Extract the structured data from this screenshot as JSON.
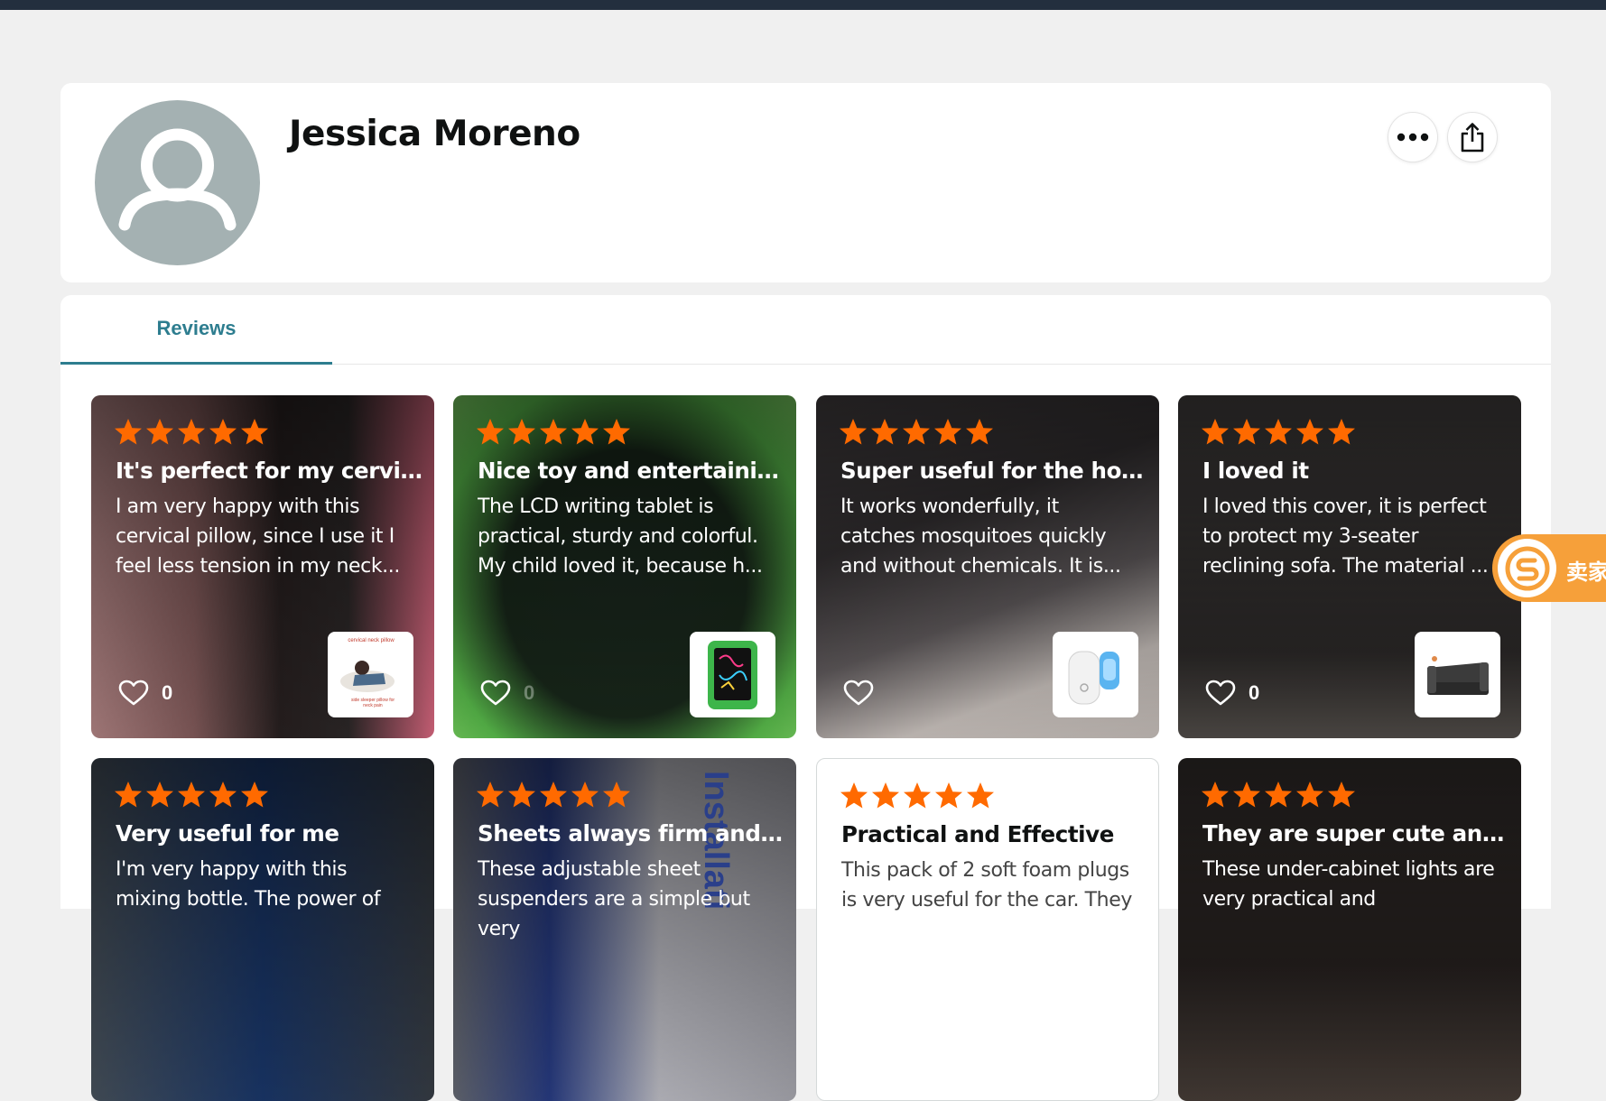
{
  "profile": {
    "name": "Jessica Moreno"
  },
  "tabs": {
    "reviews_label": "Reviews"
  },
  "colors": {
    "star": "#ff6a00",
    "accent": "#2d7d8f",
    "avatar_bg": "#a4b1b2"
  },
  "reviews": [
    {
      "rating": 5,
      "title": "It's perfect for my cervical",
      "body": "I am very happy with this cervical pillow, since I use it I feel less tension in my neck...",
      "likes": "0",
      "thumb_text_1": "cervical neck pillow",
      "thumb_text_2": "side sleeper pillow for neck pain"
    },
    {
      "rating": 5,
      "title": "Nice toy and entertaining",
      "body": "The LCD writing tablet is practical, sturdy and colorful. My child loved it, because h...",
      "likes": "0"
    },
    {
      "rating": 5,
      "title": "Super useful for the home",
      "body": "It works wonderfully, it catches mosquitoes quickly and without chemicals. It is...",
      "likes": ""
    },
    {
      "rating": 5,
      "title": "I loved it",
      "body": "I loved this cover, it is perfect to protect my 3-seater reclining sofa. The material ...",
      "likes": "0"
    },
    {
      "rating": 5,
      "title": "Very useful for me",
      "body": "I'm very happy with this mixing bottle. The power of"
    },
    {
      "rating": 5,
      "title": "Sheets always firm and ti...",
      "body": "These adjustable sheet suspenders are a simple but very",
      "photo_text": "Installati"
    },
    {
      "rating": 5,
      "title": "Practical and Effective",
      "body": "This pack of 2 soft foam plugs is very useful for the car. They"
    },
    {
      "rating": 5,
      "title": "They are super cute and ...",
      "body": "These under-cabinet lights are very practical and"
    }
  ],
  "seller_widget": {
    "label": "卖家"
  }
}
